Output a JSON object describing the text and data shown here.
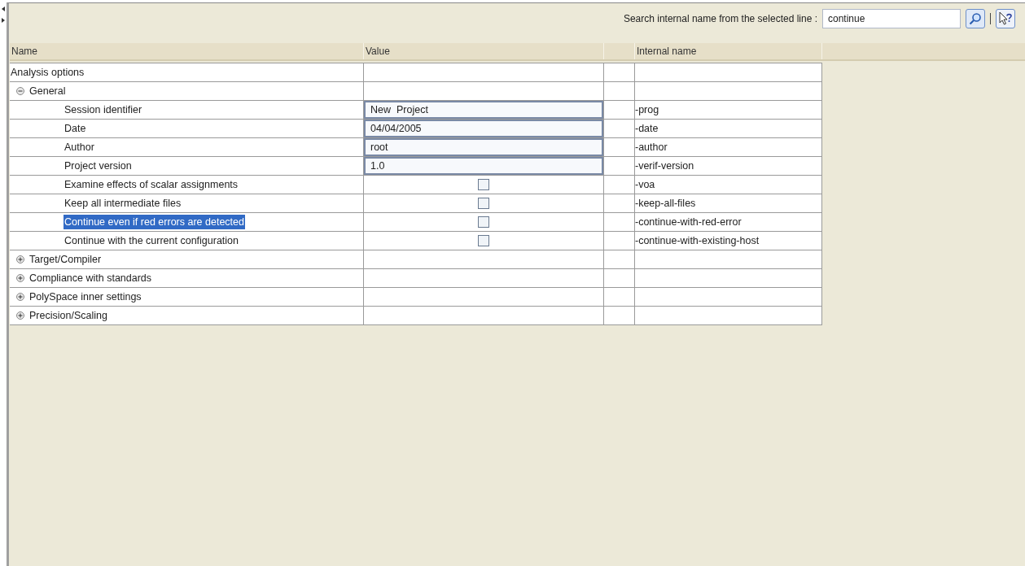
{
  "search": {
    "label": "Search internal name from the selected line :",
    "value": "continue"
  },
  "columns": [
    "Name",
    "Value",
    "Internal name"
  ],
  "tree": {
    "label": "Analysis options",
    "children": [
      {
        "label": "General",
        "expanded": true,
        "children": [
          {
            "kind": "text",
            "name": "Session identifier",
            "value": "New  Project",
            "internal": "-prog",
            "selected": false
          },
          {
            "kind": "text",
            "name": "Date",
            "value": "04/04/2005",
            "internal": "-date",
            "selected": false
          },
          {
            "kind": "text",
            "name": "Author",
            "value": "root",
            "internal": "-author",
            "selected": false
          },
          {
            "kind": "text",
            "name": "Project version",
            "value": "1.0",
            "internal": "-verif-version",
            "selected": false
          },
          {
            "kind": "checkbox",
            "name": "Examine effects of scalar assignments",
            "checked": false,
            "internal": "-voa",
            "selected": false
          },
          {
            "kind": "checkbox",
            "name": "Keep all intermediate files",
            "checked": false,
            "internal": "-keep-all-files",
            "selected": false
          },
          {
            "kind": "checkbox",
            "name": "Continue even if red errors are detected",
            "checked": false,
            "internal": "-continue-with-red-error",
            "selected": true
          },
          {
            "kind": "checkbox",
            "name": "Continue with the current configuration",
            "checked": false,
            "internal": "-continue-with-existing-host",
            "selected": false
          }
        ]
      },
      {
        "label": "Target/Compiler",
        "expanded": false
      },
      {
        "label": "Compliance with standards",
        "expanded": false
      },
      {
        "label": "PolySpace inner settings",
        "expanded": false
      },
      {
        "label": "Precision/Scaling",
        "expanded": false
      }
    ]
  }
}
